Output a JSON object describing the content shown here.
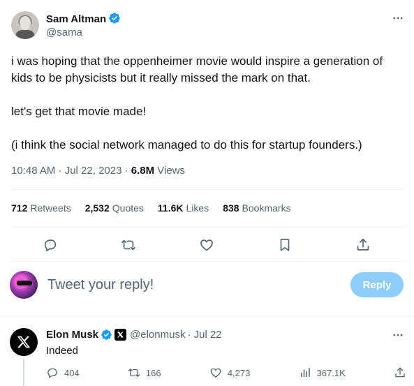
{
  "tweet": {
    "author": {
      "name": "Sam Altman",
      "handle": "@sama"
    },
    "paragraphs": [
      "i was hoping that the oppenheimer movie would inspire a generation of kids to be physicists but it really missed the mark on that.",
      "let's get that movie made!",
      "(i think the social network managed to do this for startup founders.)"
    ],
    "time": "10:48 AM · Jul 22, 2023 · ",
    "views_count": "6.8M",
    "views_label": " Views",
    "stats": {
      "retweets": {
        "num": "712",
        "label": "Retweets"
      },
      "quotes": {
        "num": "2,532",
        "label": "Quotes"
      },
      "likes": {
        "num": "11.6K",
        "label": "Likes"
      },
      "bookmarks": {
        "num": "838",
        "label": "Bookmarks"
      }
    }
  },
  "composer": {
    "placeholder": "Tweet your reply!",
    "button_label": "Reply"
  },
  "reply": {
    "author": {
      "name": "Elon Musk",
      "handle": "@elonmusk",
      "date": "· Jul 22"
    },
    "text": "Indeed",
    "counts": {
      "replies": "404",
      "retweets": "166",
      "likes": "4,273",
      "views": "367.1K"
    }
  },
  "colors": {
    "accent": "#1d9bf0",
    "reply_button": "#8ecdf8",
    "muted": "#536471"
  },
  "icons": [
    "more-icon",
    "verified-icon",
    "reply-icon",
    "retweet-icon",
    "like-icon",
    "bookmark-icon",
    "share-icon",
    "x-logo-icon",
    "views-icon"
  ]
}
